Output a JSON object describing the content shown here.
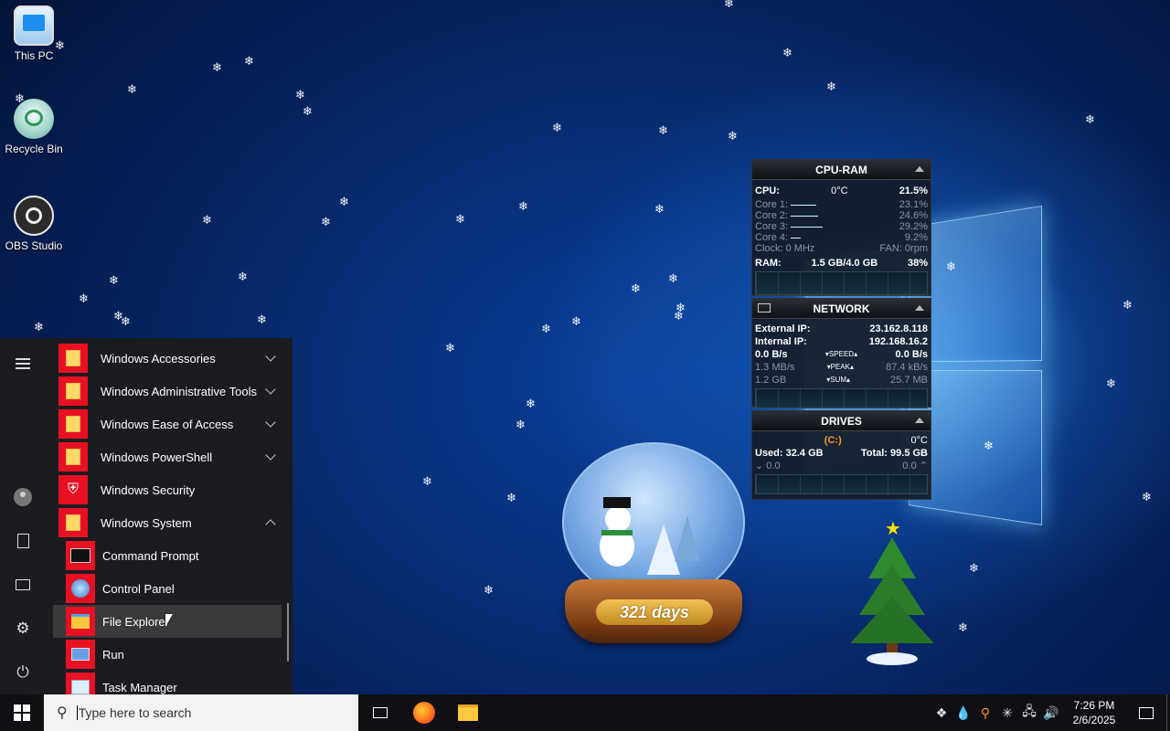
{
  "desktop": {
    "icons": [
      {
        "label": "This PC",
        "icon": "computer-icon"
      },
      {
        "label": "Recycle Bin",
        "icon": "recycle-bin-icon"
      },
      {
        "label": "OBS Studio",
        "icon": "obs-studio-icon"
      }
    ],
    "snowglobe_label": "321 days"
  },
  "cpu_ram": {
    "title": "CPU-RAM",
    "cpu_label": "CPU:",
    "cpu_temp": "0°C",
    "cpu_pct": "21.5%",
    "cores": [
      {
        "label": "Core 1:",
        "value": "23.1%",
        "pct": 23.1
      },
      {
        "label": "Core 2:",
        "value": "24.6%",
        "pct": 24.6
      },
      {
        "label": "Core 3:",
        "value": "29.2%",
        "pct": 29.2
      },
      {
        "label": "Core 4:",
        "value": "9.2%",
        "pct": 9.2
      }
    ],
    "clock": "Clock: 0 MHz",
    "fan": "FAN: 0rpm",
    "ram_label": "RAM:",
    "ram_used": "1.5 GB/4.0 GB",
    "ram_pct": "38%"
  },
  "network": {
    "title": "NETWORK",
    "external_label": "External IP:",
    "external_ip": "23.162.8.118",
    "internal_label": "Internal IP:",
    "internal_ip": "192.168.16.2",
    "speed_down": "0.0 B/s",
    "speed_label": "SPEED",
    "speed_up": "0.0 B/s",
    "peak_down": "1.3 MB/s",
    "peak_label": "PEAK",
    "peak_up": "87.4 kB/s",
    "sum_down": "1.2 GB",
    "sum_label": "SUM",
    "sum_up": "25.7 MB"
  },
  "drives": {
    "title": "DRIVES",
    "drive_letter": "(C:)",
    "temp": "0°C",
    "used": "Used: 32.4 GB",
    "total": "Total: 99.5 GB",
    "read": "0.0",
    "write": "0.0"
  },
  "start_menu": {
    "rail": [
      "menu-icon",
      "user-icon",
      "documents-icon",
      "pictures-icon",
      "settings-icon",
      "power-icon"
    ],
    "apps": [
      {
        "label": "Windows Accessories",
        "type": "folder",
        "expand": "down"
      },
      {
        "label": "Windows Administrative Tools",
        "type": "folder",
        "expand": "down"
      },
      {
        "label": "Windows Ease of Access",
        "type": "folder",
        "expand": "down"
      },
      {
        "label": "Windows PowerShell",
        "type": "folder",
        "expand": "down"
      },
      {
        "label": "Windows Security",
        "type": "shield",
        "expand": ""
      },
      {
        "label": "Windows System",
        "type": "folder",
        "expand": "up"
      },
      {
        "label": "Command Prompt",
        "type": "cmd",
        "expand": ""
      },
      {
        "label": "Control Panel",
        "type": "control-panel",
        "expand": ""
      },
      {
        "label": "File Explorer",
        "type": "file-explorer",
        "expand": ""
      },
      {
        "label": "Run",
        "type": "run",
        "expand": ""
      },
      {
        "label": "Task Manager",
        "type": "task-manager",
        "expand": ""
      }
    ]
  },
  "taskbar": {
    "search_placeholder": "Type here to search",
    "time": "7:26 PM",
    "date": "2/6/2025"
  }
}
